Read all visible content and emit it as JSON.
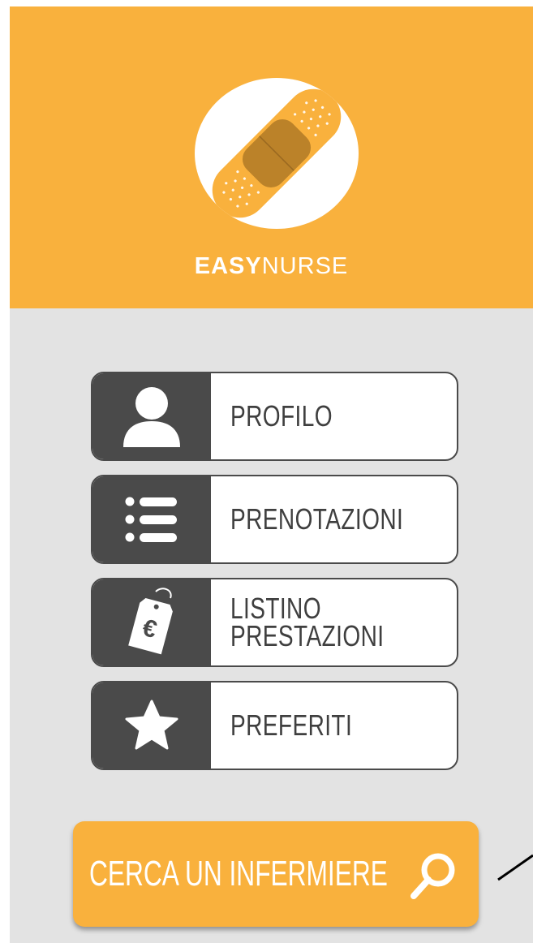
{
  "brand": {
    "name_bold": "EASY",
    "name_light": "NURSE"
  },
  "colors": {
    "accent": "#f9b13d",
    "dark": "#4a4a4a",
    "background": "#e3e3e3"
  },
  "menu": [
    {
      "label": "PROFILO",
      "icon": "user-icon"
    },
    {
      "label": "PRENOTAZIONI",
      "icon": "list-icon"
    },
    {
      "label_line1": "LISTINO",
      "label_line2": "PRESTAZIONI",
      "icon": "price-tag-euro-icon"
    },
    {
      "label": "PREFERITI",
      "icon": "star-icon"
    }
  ],
  "cta": {
    "label": "CERCA UN INFERMIERE",
    "icon": "search-icon"
  }
}
